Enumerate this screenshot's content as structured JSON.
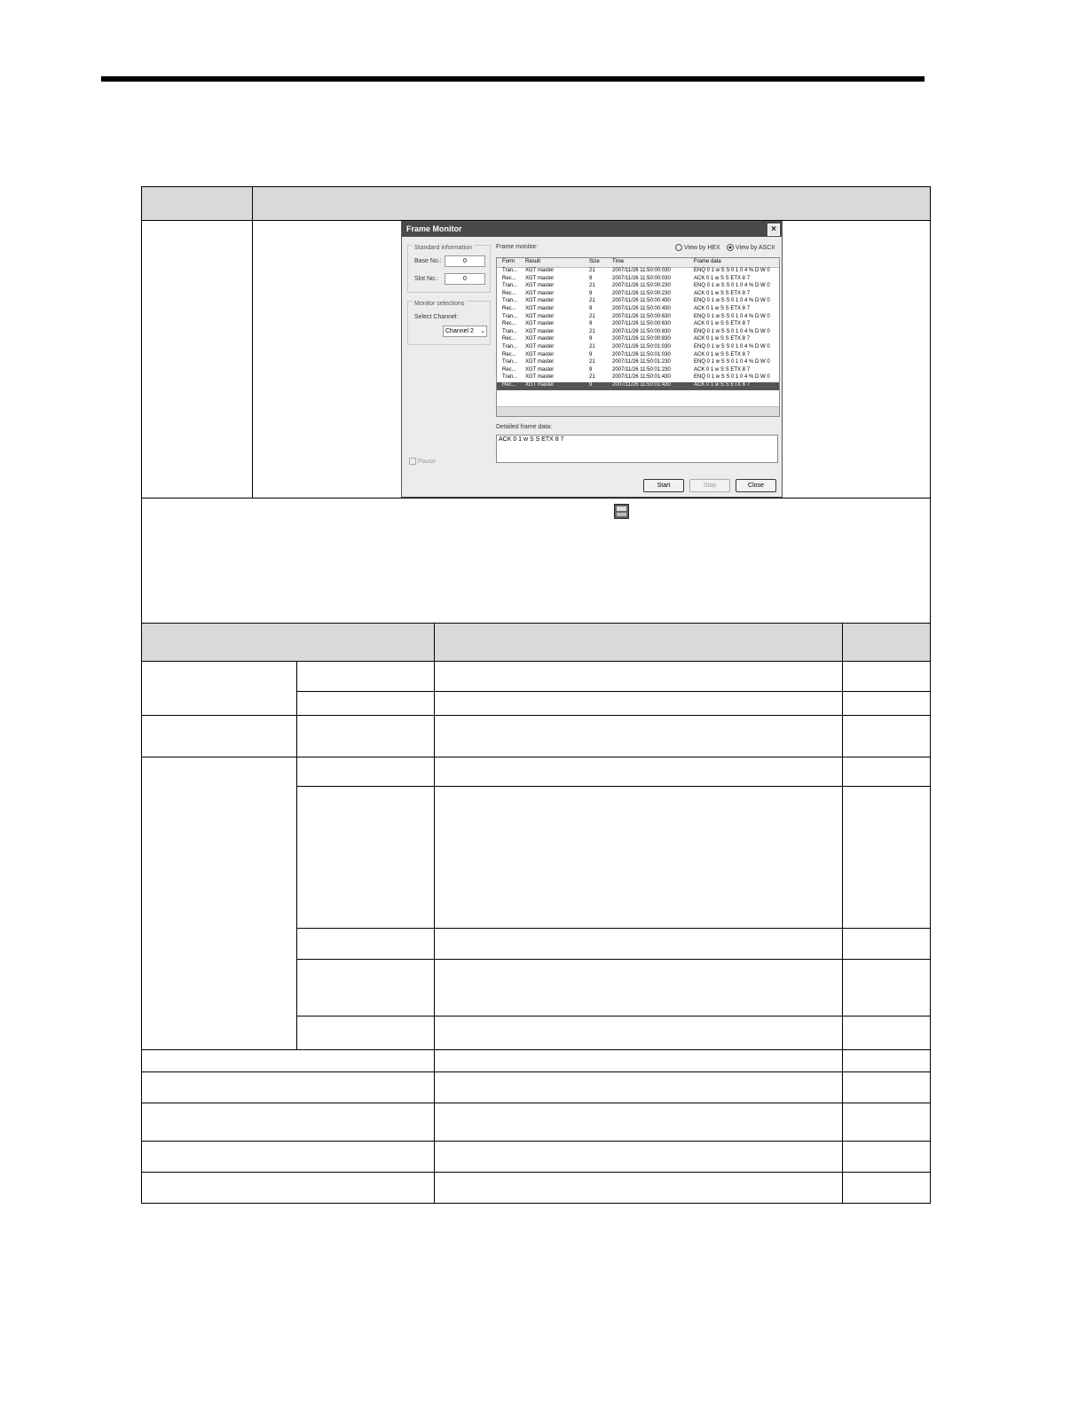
{
  "frame_monitor": {
    "title": "Frame Monitor",
    "close_label": "×",
    "standard_info_label": "Standard information",
    "base_no_label": "Base No.:",
    "base_no_value": "0",
    "slot_no_label": "Slot No.:",
    "slot_no_value": "0",
    "monitor_selections_label": "Monitor selections",
    "select_channel_label": "Select Channel:",
    "channel_value": "Channel 2",
    "frame_monitor_label": "Frame monitor:",
    "view_hex_label": "View by HEX",
    "view_ascii_label": "View by ASCII",
    "columns": [
      "Form",
      "Result",
      "Size",
      "Time",
      "Frame data"
    ],
    "rows": [
      [
        "Tran...",
        "XGT master",
        "21",
        "2007/11/26 11:50:00:030",
        "ENQ 0 1 w S S 0 1 0 4 % D W 0"
      ],
      [
        "Rec...",
        "XGT master",
        "9",
        "2007/11/26 11:50:00:030",
        "ACK 0 1 w S S ETX 8 7"
      ],
      [
        "Tran...",
        "XGT master",
        "21",
        "2007/11/26 11:50:00:230",
        "ENQ 0 1 w S S 0 1 0 4 % D W 0"
      ],
      [
        "Rec...",
        "XGT master",
        "9",
        "2007/11/26 11:50:00:230",
        "ACK 0 1 w S S ETX 8 7"
      ],
      [
        "Tran...",
        "XGT master",
        "21",
        "2007/11/26 11:50:00:430",
        "ENQ 0 1 w S S 0 1 0 4 % D W 0"
      ],
      [
        "Rec...",
        "XGT master",
        "9",
        "2007/11/26 11:50:00:430",
        "ACK 0 1 w S S ETX 8 7"
      ],
      [
        "Tran...",
        "XGT master",
        "21",
        "2007/11/26 11:50:00:630",
        "ENQ 0 1 w S S 0 1 0 4 % D W 0"
      ],
      [
        "Rec...",
        "XGT master",
        "9",
        "2007/11/26 11:50:00:630",
        "ACK 0 1 w S S ETX 8 7"
      ],
      [
        "Tran...",
        "XGT master",
        "21",
        "2007/11/26 11:50:00:830",
        "ENQ 0 1 w S S 0 1 0 4 % D W 0"
      ],
      [
        "Rec...",
        "XGT master",
        "9",
        "2007/11/26 11:50:00:830",
        "ACK 0 1 w S S ETX 8 7"
      ],
      [
        "Tran...",
        "XGT master",
        "21",
        "2007/11/26 11:50:01:030",
        "ENQ 0 1 w S S 0 1 0 4 % D W 0"
      ],
      [
        "Rec...",
        "XGT master",
        "9",
        "2007/11/26 11:50:01:030",
        "ACK 0 1 w S S ETX 8 7"
      ],
      [
        "Tran...",
        "XGT master",
        "21",
        "2007/11/26 11:50:01:230",
        "ENQ 0 1 w S S 0 1 0 4 % D W 0"
      ],
      [
        "Rec...",
        "XGT master",
        "9",
        "2007/11/26 11:50:01:230",
        "ACK 0 1 w S S ETX 8 7"
      ],
      [
        "Tran...",
        "XGT master",
        "21",
        "2007/11/26 11:50:01:430",
        "ENQ 0 1 w S S 0 1 0 4 % D W 0"
      ],
      [
        "Rec...",
        "XGT master",
        "9",
        "2007/11/26 11:50:01:430",
        "ACK 0 1 w S S ETX 8 7"
      ]
    ],
    "selected_row": 15,
    "detailed_label": "Detailed frame data:",
    "detailed_value": "ACK 0 1 w S S ETX 8 7",
    "pause_label": "Pause",
    "start_label": "Start",
    "stop_label": "Stop",
    "close_button_label": "Close"
  },
  "icons": {
    "toolbar_icon": "frame-monitor-icon"
  }
}
